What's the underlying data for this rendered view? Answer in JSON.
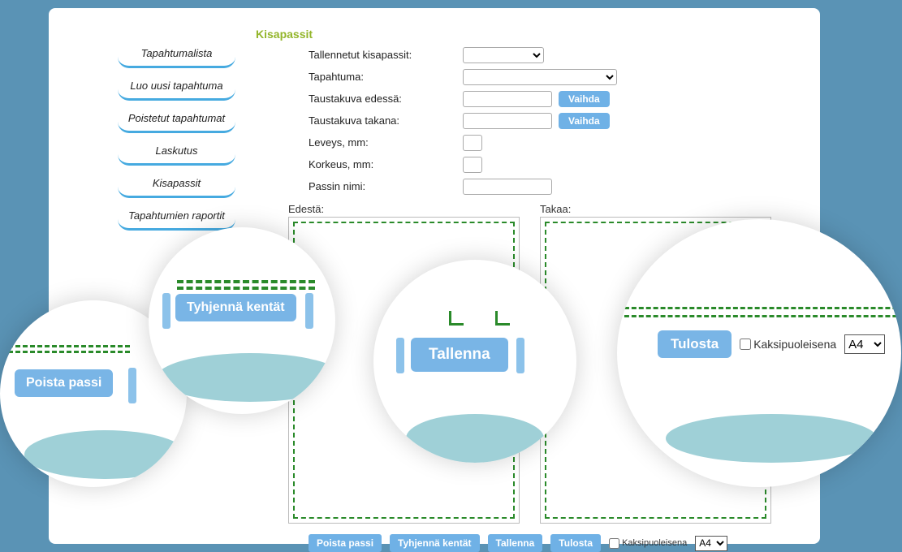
{
  "page_title": "Kisapassit",
  "sidebar": {
    "items": [
      {
        "label": "Tapahtumalista"
      },
      {
        "label": "Luo uusi tapahtuma"
      },
      {
        "label": "Poistetut tapahtumat"
      },
      {
        "label": "Laskutus"
      },
      {
        "label": "Kisapassit"
      },
      {
        "label": "Tapahtumien raportit"
      }
    ]
  },
  "form": {
    "saved_passes_label": "Tallennetut kisapassit:",
    "event_label": "Tapahtuma:",
    "bg_front_label": "Taustakuva edessä:",
    "bg_back_label": "Taustakuva takana:",
    "width_label": "Leveys, mm:",
    "height_label": "Korkeus, mm:",
    "pass_name_label": "Passin nimi:",
    "change_btn": "Vaihda"
  },
  "canvases": {
    "front_label": "Edestä:",
    "back_label": "Takaa:"
  },
  "actions": {
    "delete_pass": "Poista passi",
    "clear_fields": "Tyhjennä kentät",
    "save": "Tallenna",
    "print": "Tulosta",
    "duplex_label": "Kaksipuoleisena",
    "paper_size": "A4"
  }
}
